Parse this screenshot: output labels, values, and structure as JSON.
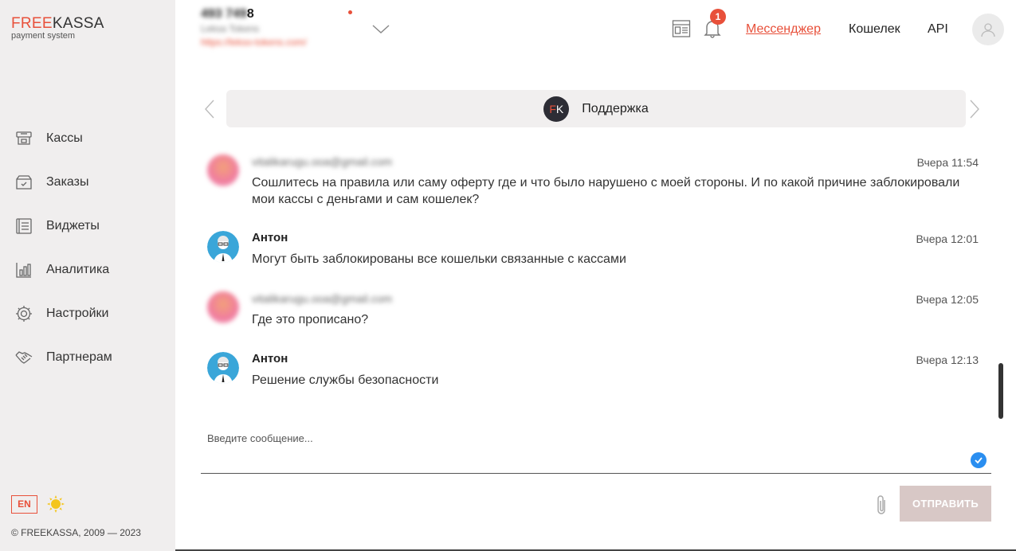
{
  "logo": {
    "brand_first": "FREE",
    "brand_second": "KASSA",
    "tagline": "payment system"
  },
  "sidebar": {
    "items": [
      {
        "label": "Кассы",
        "icon": "cash-register-icon"
      },
      {
        "label": "Заказы",
        "icon": "box-icon"
      },
      {
        "label": "Виджеты",
        "icon": "widgets-icon"
      },
      {
        "label": "Аналитика",
        "icon": "chart-icon"
      },
      {
        "label": "Настройки",
        "icon": "gear-icon"
      },
      {
        "label": "Партнерам",
        "icon": "handshake-icon"
      }
    ],
    "lang": "EN",
    "copyright": "© FREEKASSA, 2009 — 2023"
  },
  "header": {
    "merchant_id_hidden": "493 749",
    "merchant_id_visible": "8",
    "merchant_name": "Leksa Tokens",
    "merchant_url": "https://lekso-tokens.com/",
    "notifications_count": "1",
    "links": {
      "messenger": "Мессенджер",
      "wallet": "Кошелек",
      "api": "API"
    }
  },
  "chat": {
    "title": "Поддержка",
    "logo_text_f": "F",
    "logo_text_k": "K",
    "messages": [
      {
        "sender": "vitalikarugu.ooa@gmail.com",
        "time": "Вчера 11:54",
        "text": "Сошлитесь на правила или саму оферту где и что было нарушено с моей стороны. И по какой причине заблокировали мои кассы с деньгами и сам кошелек?"
      },
      {
        "sender": "Антон",
        "time": "Вчера 12:01",
        "text": "Могут быть заблокированы все кошельки связанные с кассами"
      },
      {
        "sender": "vitalikarugu.ooa@gmail.com",
        "time": "Вчера 12:05",
        "text": "Где это прописано?"
      },
      {
        "sender": "Антон",
        "time": "Вчера 12:13",
        "text": "Решение службы безопасности"
      }
    ]
  },
  "composer": {
    "placeholder": "Введите сообщение...",
    "send_label": "ОТПРАВИТЬ"
  },
  "colors": {
    "accent": "#e8503a",
    "send_disabled": "#d8c8c6",
    "sidebar_bg": "#f0eeee",
    "check_blue": "#2a8ef0"
  }
}
